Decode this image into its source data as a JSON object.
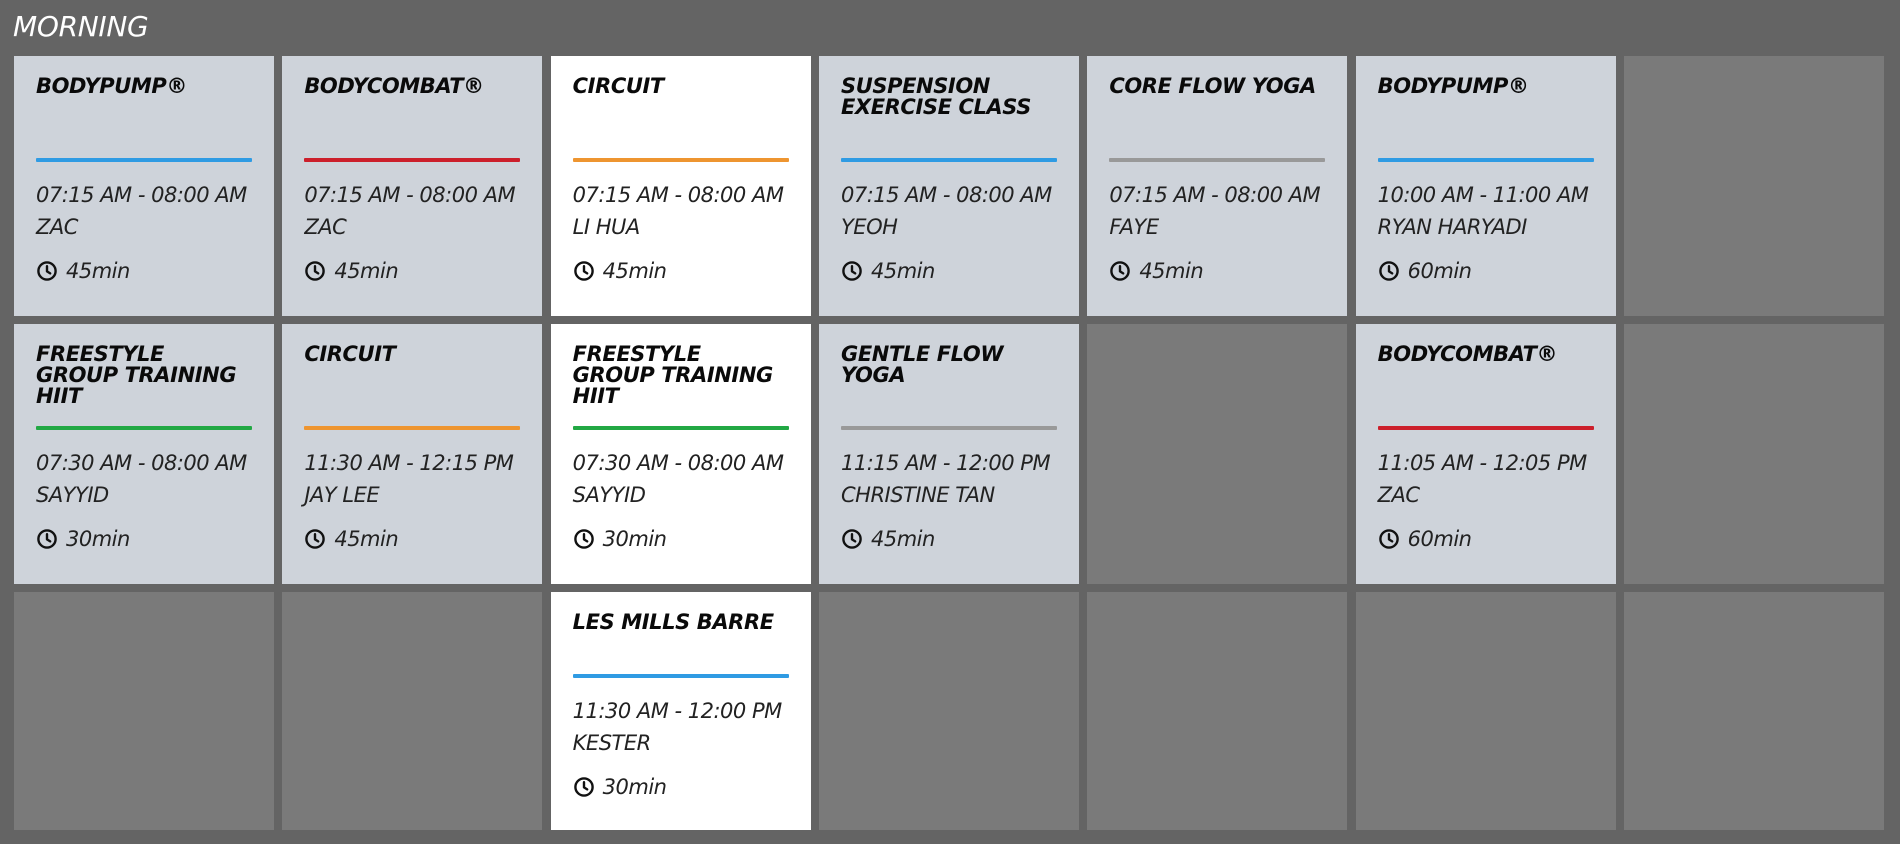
{
  "section": {
    "title": "MORNING"
  },
  "colors": {
    "blue": "#2f9be3",
    "red": "#cc1f2b",
    "orange": "#ee9530",
    "gray": "#999999",
    "green": "#22a844",
    "card_bg": "#ced3da",
    "card_highlight_bg": "#ffffff",
    "empty_slot_bg": "#7a7a7a",
    "page_bg": "#646464"
  },
  "icons": {
    "duration": "clock-icon"
  },
  "classes": [
    {
      "name": "BODYPUMP®",
      "time": "07:15 AM - 08:00 AM",
      "instructor": "ZAC",
      "duration": "45min",
      "accent": "blue"
    },
    {
      "name": "BODYCOMBAT®",
      "time": "07:15 AM - 08:00 AM",
      "instructor": "ZAC",
      "duration": "45min",
      "accent": "red"
    },
    {
      "name": "CIRCUIT",
      "time": "07:15 AM - 08:00 AM",
      "instructor": "LI HUA",
      "duration": "45min",
      "accent": "orange"
    },
    {
      "name": "SUSPENSION EXERCISE CLASS",
      "time": "07:15 AM - 08:00 AM",
      "instructor": "YEOH",
      "duration": "45min",
      "accent": "blue"
    },
    {
      "name": "CORE FLOW YOGA",
      "time": "07:15 AM - 08:00 AM",
      "instructor": "FAYE",
      "duration": "45min",
      "accent": "gray"
    },
    {
      "name": "BODYPUMP®",
      "time": "10:00 AM - 11:00 AM",
      "instructor": "RYAN HARYADI",
      "duration": "60min",
      "accent": "blue"
    },
    {
      "name": "FREESTYLE GROUP TRAINING HIIT",
      "time": "07:30 AM - 08:00 AM",
      "instructor": "SAYYID",
      "duration": "30min",
      "accent": "green"
    },
    {
      "name": "CIRCUIT",
      "time": "11:30 AM - 12:15 PM",
      "instructor": "JAY LEE",
      "duration": "45min",
      "accent": "orange"
    },
    {
      "name": "FREESTYLE GROUP TRAINING HIIT",
      "time": "07:30 AM - 08:00 AM",
      "instructor": "SAYYID",
      "duration": "30min",
      "accent": "green"
    },
    {
      "name": "GENTLE FLOW YOGA",
      "time": "11:15 AM - 12:00 PM",
      "instructor": "CHRISTINE TAN",
      "duration": "45min",
      "accent": "gray"
    },
    {
      "name": "BODYCOMBAT®",
      "time": "11:05 AM - 12:05 PM",
      "instructor": "ZAC",
      "duration": "60min",
      "accent": "red"
    },
    {
      "name": "LES MILLS BARRE",
      "time": "11:30 AM - 12:00 PM",
      "instructor": "KESTER",
      "duration": "30min",
      "accent": "blue"
    }
  ]
}
